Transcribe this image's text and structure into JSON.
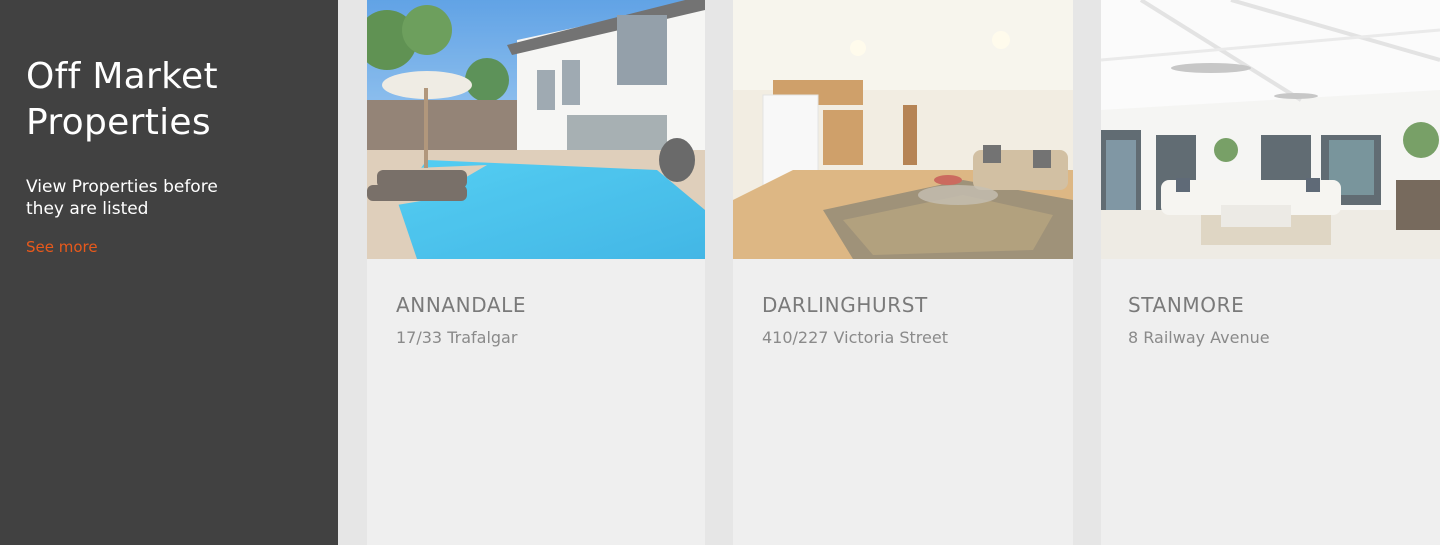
{
  "sidebar": {
    "title_line1": "Off Market",
    "title_line2": "Properties",
    "subtitle": "View Properties before they are listed",
    "link_label": "See more"
  },
  "colors": {
    "sidebar_bg": "#414141",
    "accent": "#e8591b",
    "card_bg": "#efefef",
    "page_bg": "#e6e6e6"
  },
  "cards": [
    {
      "suburb": "ANNANDALE",
      "address": "17/33 Trafalgar",
      "image": "pool-house-photo"
    },
    {
      "suburb": "DARLINGHURST",
      "address": "410/227 Victoria Street",
      "image": "apartment-living-photo"
    },
    {
      "suburb": "STANMORE",
      "address": "8 Railway Avenue",
      "image": "bright-living-room-photo"
    }
  ]
}
